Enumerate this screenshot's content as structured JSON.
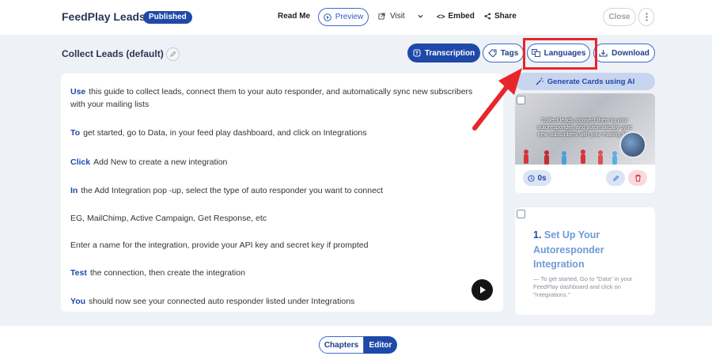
{
  "header": {
    "app_title": "FeedPlay Leads",
    "status_badge": "Published",
    "read_me": "Read Me",
    "preview": "Preview",
    "visit": "Visit",
    "embed": "Embed",
    "share": "Share",
    "close": "Close"
  },
  "section": {
    "title": "Collect Leads (default)"
  },
  "tabs": {
    "transcription": "Transcription",
    "tags": "Tags",
    "languages": "Languages",
    "download": "Download"
  },
  "transcript": {
    "lines": [
      {
        "kw": "Use",
        "text": "this guide to collect leads, connect them to your auto responder, and automatically sync new subscribers"
      },
      {
        "kw": "",
        "text": "with your mailing lists"
      },
      {
        "kw": "To",
        "text": "get started, go to Data, in your feed play dashboard, and click on Integrations"
      },
      {
        "kw": "Click",
        "text": "Add New to create a new integration"
      },
      {
        "kw": "In",
        "text": "the Add Integration pop -up, select the type of auto responder you want to connect"
      },
      {
        "kw": "",
        "text": "EG, MailChimp, Active Campaign, Get Response, etc"
      },
      {
        "kw": "",
        "text": "Enter a name for the integration, provide your API key and secret key if prompted"
      },
      {
        "kw": "Test",
        "text": "the connection, then create the integration"
      },
      {
        "kw": "You",
        "text": "should now see your connected auto responder listed under Integrations"
      }
    ]
  },
  "sidebar": {
    "generate_cards": "Generate Cards using AI",
    "card1": {
      "thumb_text": "Collect leads, connect them to your autoresponder, and automatically sync new subscribers with your mailing lists",
      "duration": "0s"
    },
    "card2": {
      "number": "1.",
      "title": "Set Up Your Autoresponder Integration",
      "description": "— To get started, Go to \"Data\" in your FeedPlay dashboard and click on \"Integrations.\""
    }
  },
  "footer": {
    "chapters": "Chapters",
    "editor": "Editor"
  },
  "colors": {
    "primary": "#1f49a8",
    "highlight": "#e8262a",
    "background": "#eef1f6"
  }
}
